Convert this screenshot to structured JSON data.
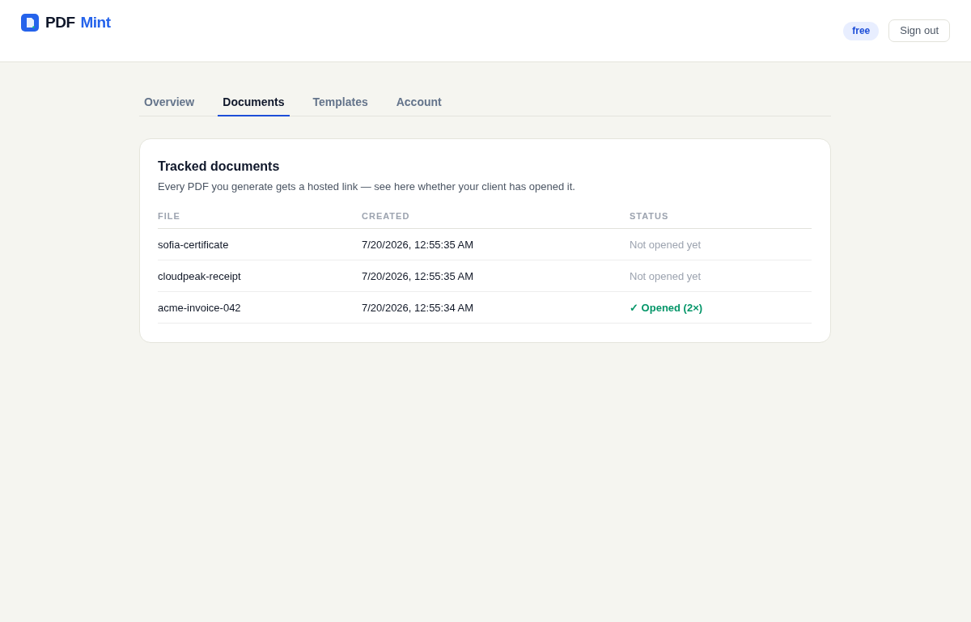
{
  "header": {
    "brand": {
      "first": "PDF",
      "second": "Mint"
    },
    "plan_badge": "free",
    "sign_out": "Sign out"
  },
  "tabs": [
    {
      "label": "Overview",
      "selected": false
    },
    {
      "label": "Documents",
      "selected": true
    },
    {
      "label": "Templates",
      "selected": false
    },
    {
      "label": "Account",
      "selected": false
    }
  ],
  "card": {
    "title": "Tracked documents",
    "description": "Every PDF you generate gets a hosted link — see here whether your client has opened it.",
    "table": {
      "columns": [
        "FILE",
        "CREATED",
        "STATUS"
      ],
      "rows": [
        {
          "file": "sofia-certificate",
          "created": "7/20/2026, 12:55:35 AM",
          "status": {
            "kind": "not_opened",
            "text": "Not opened yet"
          }
        },
        {
          "file": "cloudpeak-receipt",
          "created": "7/20/2026, 12:55:35 AM",
          "status": {
            "kind": "not_opened",
            "text": "Not opened yet"
          }
        },
        {
          "file": "acme-invoice-042",
          "created": "7/20/2026, 12:55:34 AM",
          "status": {
            "kind": "opened",
            "text": "✓ Opened (2×)"
          }
        }
      ]
    }
  }
}
